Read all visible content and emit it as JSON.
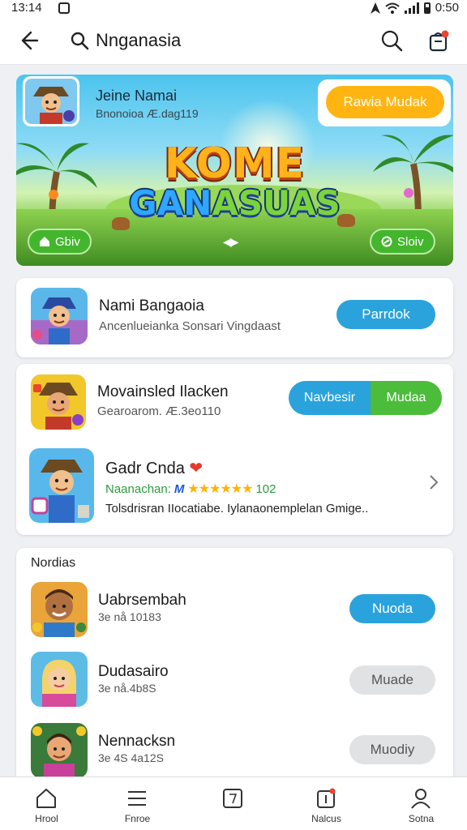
{
  "status_bar": {
    "time": "13:14",
    "battery": "0:50"
  },
  "header": {
    "title": "Nnganasia"
  },
  "banner": {
    "app_name": "Jeine Namai",
    "app_sub": "Bnonoioa Æ.dag119",
    "action_label": "Rawia Mudak",
    "title_line1": "KOME",
    "title_line2_a": "GAN",
    "title_line2_b": "ASUAS",
    "left_pill": "Gbiv",
    "right_pill": "Sloiv",
    "pager": "◀▶"
  },
  "featured": {
    "name": "Nami Bangaoia",
    "sub": "Ancenlueianka Sonsari Vingdaast",
    "action_label": "Parrdok"
  },
  "promo": {
    "item1": {
      "name": "Movainsled Ilacken",
      "sub": "Gearoarom. Æ.3eo110",
      "btn_a": "Navbesir",
      "btn_b": "Mudaa"
    },
    "item2": {
      "name": "Gadr Cnda",
      "heart": "❤",
      "rating_label": "Naanachan:",
      "rating_mark": "M",
      "stars": "★★★★★★",
      "rating_count": "102",
      "desc": "Tolsdrisran IIocatiabe. Iylanaonemplelan Gmige.."
    }
  },
  "list": {
    "section_title": "Nordias",
    "items": [
      {
        "name": "Uabrsembah",
        "sub": "3e nå 10183",
        "action": "Nuoda",
        "style": "blue"
      },
      {
        "name": "Dudasairo",
        "sub": "3e nå.4b8S",
        "action": "Muade",
        "style": "grey"
      },
      {
        "name": "Nennacksn",
        "sub": "3e 4S 4a12S",
        "action": "Muodiy",
        "style": "grey"
      }
    ]
  },
  "bottom_nav": [
    {
      "label": "Hrool",
      "icon": "home-icon"
    },
    {
      "label": "Fnroe",
      "icon": "menu-icon"
    },
    {
      "label": "",
      "icon": "book-icon"
    },
    {
      "label": "Nalcus",
      "icon": "notifications-icon"
    },
    {
      "label": "Sotna",
      "icon": "profile-icon"
    }
  ],
  "colors": {
    "accent_blue": "#2aa3dd",
    "accent_green": "#4cbc3b",
    "accent_orange": "#ffb411",
    "notify_red": "#e9452f"
  }
}
